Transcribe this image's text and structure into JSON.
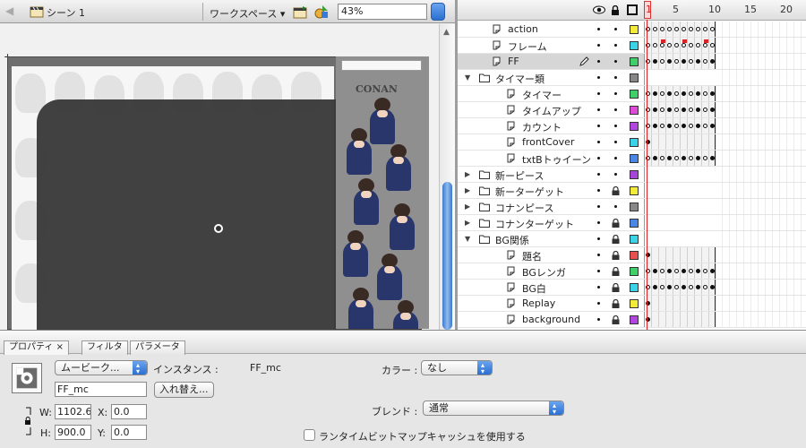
{
  "toolbar": {
    "scene_label": "シーン 1",
    "workspace_label": "ワークスペース ▾",
    "zoom_value": "43%"
  },
  "stage": {
    "art_title": "CONAN"
  },
  "timeline": {
    "frame_numbers": [
      "1",
      "5",
      "10",
      "15",
      "20"
    ],
    "layers": [
      {
        "name": "action",
        "type": "layer",
        "indent": 1,
        "color": "#f3ea3a",
        "locked": false
      },
      {
        "name": "フレーム",
        "type": "layer",
        "indent": 1,
        "color": "#3ad3e8",
        "locked": false
      },
      {
        "name": "FF",
        "type": "layer",
        "indent": 1,
        "color": "#3fd06a",
        "locked": false,
        "selected": true
      },
      {
        "name": "タイマー類",
        "type": "folder-open",
        "indent": 0,
        "color": "#888888",
        "locked": false
      },
      {
        "name": "タイマー",
        "type": "layer",
        "indent": 2,
        "color": "#3fd06a",
        "locked": false
      },
      {
        "name": "タイムアップ",
        "type": "layer",
        "indent": 2,
        "color": "#e04ad8",
        "locked": false
      },
      {
        "name": "カウント",
        "type": "layer",
        "indent": 2,
        "color": "#b045e0",
        "locked": false
      },
      {
        "name": "frontCover",
        "type": "layer",
        "indent": 2,
        "color": "#3ad3e8",
        "locked": false
      },
      {
        "name": "txtBトゥイーン",
        "type": "layer",
        "indent": 2,
        "color": "#4a86e8",
        "locked": false
      },
      {
        "name": "新ーピース",
        "type": "folder",
        "indent": 0,
        "color": "#a745d8",
        "locked": false
      },
      {
        "name": "新ーターゲット",
        "type": "folder",
        "indent": 0,
        "color": "#f3ea3a",
        "locked": true
      },
      {
        "name": "コナンピース",
        "type": "folder",
        "indent": 0,
        "color": "#888888",
        "locked": false
      },
      {
        "name": "コナンターゲット",
        "type": "folder",
        "indent": 0,
        "color": "#4a86e8",
        "locked": true
      },
      {
        "name": "BG関係",
        "type": "folder-open",
        "indent": 0,
        "color": "#3ad3e8",
        "locked": true
      },
      {
        "name": "題名",
        "type": "layer",
        "indent": 2,
        "color": "#e85050",
        "locked": true
      },
      {
        "name": "BGレンガ",
        "type": "layer",
        "indent": 2,
        "color": "#3fd06a",
        "locked": true
      },
      {
        "name": "BG白",
        "type": "layer",
        "indent": 2,
        "color": "#3ad3e8",
        "locked": true
      },
      {
        "name": "Replay",
        "type": "layer",
        "indent": 2,
        "color": "#f3ea3a",
        "locked": true
      },
      {
        "name": "background",
        "type": "layer",
        "indent": 2,
        "color": "#b045e0",
        "locked": true
      }
    ]
  },
  "properties": {
    "tabs": [
      "プロパティ ×",
      "フィルタ",
      "パラメータ"
    ],
    "symbol_type": "ムービーク...",
    "instance_label": "インスタンス :",
    "instance_name": "FF_mc",
    "instance_field": "FF_mc",
    "swap_button": "入れ替え...",
    "color_label": "カラー :",
    "color_value": "なし",
    "blend_label": "ブレンド :",
    "blend_value": "通常",
    "w_label": "W:",
    "w_value": "1102.6",
    "x_label": "X:",
    "x_value": "0.0",
    "h_label": "H:",
    "h_value": "900.0",
    "y_label": "Y:",
    "y_value": "0.0",
    "cache_label": "ランタイムビットマップキャッシュを使用する"
  }
}
